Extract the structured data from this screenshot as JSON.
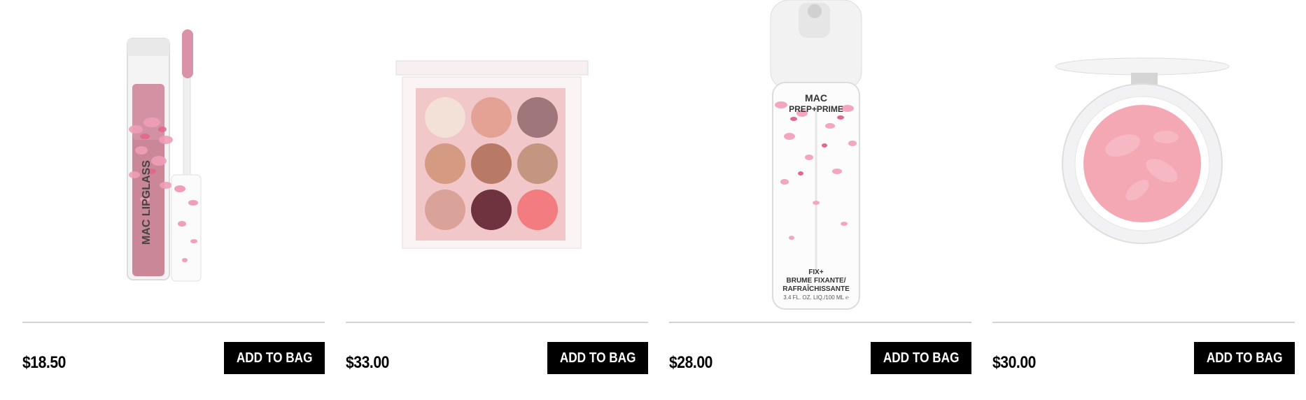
{
  "products": [
    {
      "name": "lipglass",
      "price": "$18.50",
      "button_label": "ADD TO BAG",
      "brand_text": "MAC",
      "product_text": "LIPGLASS",
      "colors": {
        "tube": "#c98797",
        "petal": "#ef9fb8"
      }
    },
    {
      "name": "eyeshadow-palette",
      "price": "$33.00",
      "button_label": "ADD TO BAG",
      "colors": {
        "pans": [
          "#f3e0d6",
          "#e3a293",
          "#9f7679",
          "#d49a82",
          "#b87a66",
          "#c49681",
          "#d9a39a",
          "#6f3340",
          "#f27c80"
        ]
      }
    },
    {
      "name": "prep-prime-fix-spray",
      "price": "$28.00",
      "button_label": "ADD TO BAG",
      "brand_text": "MAC",
      "product_text": "PREP+PRIME",
      "label_lines": [
        "FIX+",
        "BRUME FIXANTE/",
        "RAFRAÎCHISSANTE",
        "3.4 FL. OZ. LIQ./100 ML ℮"
      ]
    },
    {
      "name": "highlighter-compact",
      "price": "$30.00",
      "button_label": "ADD TO BAG",
      "colors": {
        "powder": "#f4a8b4",
        "case": "#f2f2f4"
      }
    }
  ]
}
